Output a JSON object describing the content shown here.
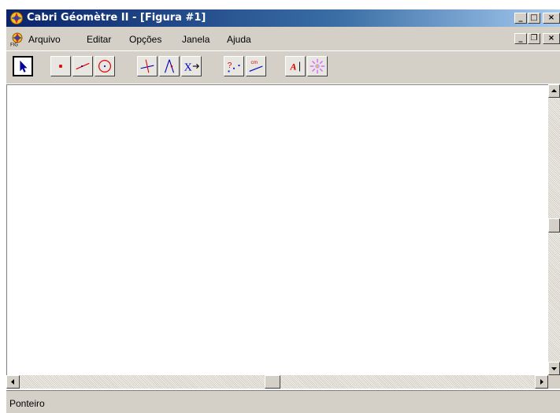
{
  "window": {
    "title": "Cabri Géomètre II - [Figura  #1]",
    "caption_buttons": {
      "minimize": "_",
      "maximize": "□",
      "close": "×"
    },
    "mdi_buttons": {
      "minimize": "_",
      "restore": "❐",
      "close": "×"
    }
  },
  "menu": {
    "items": [
      {
        "label": "Arquivo"
      },
      {
        "label": "Editar"
      },
      {
        "label": "Opções"
      },
      {
        "label": "Janela"
      },
      {
        "label": "Ajuda"
      }
    ]
  },
  "toolbar": {
    "tools": [
      {
        "icon": "pointer-arrow-icon",
        "active": true
      },
      {
        "icon": "point-icon"
      },
      {
        "icon": "line-icon"
      },
      {
        "icon": "circle-icon"
      },
      {
        "icon": "perpendicular-line-icon"
      },
      {
        "icon": "midpoint-icon"
      },
      {
        "icon": "transform-icon",
        "text": "X"
      },
      {
        "icon": "check-property-icon",
        "text": "?"
      },
      {
        "icon": "measure-icon",
        "text": "cm"
      },
      {
        "icon": "text-label-icon",
        "text": "A"
      },
      {
        "icon": "display-color-icon"
      }
    ]
  },
  "statusbar": {
    "text": "Ponteiro"
  },
  "colors": {
    "titlebar_start": "#0a246a",
    "titlebar_end": "#a6caf0",
    "chrome": "#d4d0c8",
    "tool_red": "#e00000",
    "tool_blue": "#0000c0"
  }
}
